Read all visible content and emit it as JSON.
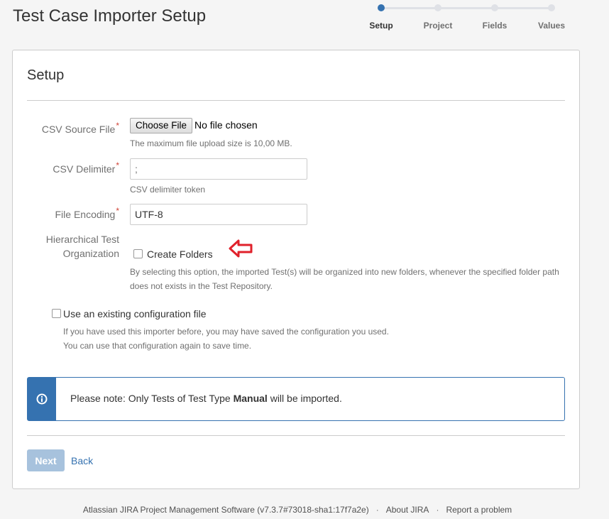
{
  "page": {
    "title": "Test Case Importer Setup"
  },
  "tracker": {
    "steps": [
      {
        "label": "Setup",
        "active": true
      },
      {
        "label": "Project",
        "active": false
      },
      {
        "label": "Fields",
        "active": false
      },
      {
        "label": "Values",
        "active": false
      }
    ]
  },
  "panel": {
    "title": "Setup",
    "csv_source": {
      "label": "CSV Source File",
      "required": "*",
      "button": "Choose File",
      "status": "No file chosen",
      "help": "The maximum file upload size is 10,00 MB."
    },
    "csv_delimiter": {
      "label": "CSV Delimiter",
      "required": "*",
      "value": ";",
      "help": "CSV delimiter token"
    },
    "file_encoding": {
      "label": "File Encoding",
      "required": "*",
      "value": "UTF-8"
    },
    "hierarchy": {
      "label_line1": "Hierarchical Test",
      "label_line2": "Organization",
      "checkbox_label": "Create Folders",
      "checked": false,
      "help_line1": "By selecting this option, the imported Test(s) will be organized into new folders, whenever the specified folder path",
      "help_line2": "does not exists in the Test Repository."
    },
    "existing_config": {
      "checkbox_label": "Use an existing configuration file",
      "checked": false,
      "help_line1": "If you have used this importer before, you may have saved the configuration you used.",
      "help_line2": "You can use that configuration again to save time."
    },
    "note": {
      "icon": "info-icon",
      "text_before": "Please note: Only Tests of Test Type ",
      "text_bold": "Manual",
      "text_after": " will be imported."
    },
    "buttons": {
      "next": "Next",
      "back": "Back"
    }
  },
  "footer": {
    "product": "Atlassian JIRA Project Management Software (v7.3.7#73018-sha1:17f7a2e)",
    "separator": "·",
    "about": "About JIRA",
    "report": "Report a problem"
  },
  "colors": {
    "accent": "#3572b0",
    "required": "#d04437",
    "annotation_arrow": "#e0212b",
    "next_disabled": "#a7c2dd"
  }
}
